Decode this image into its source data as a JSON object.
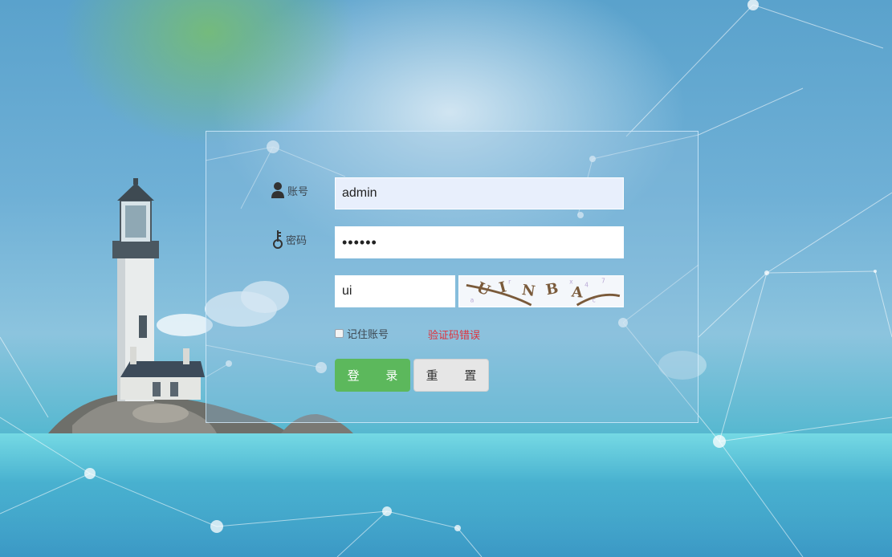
{
  "login": {
    "account_label": "账号",
    "password_label": "密码",
    "account_value": "admin",
    "password_value": "••••••",
    "captcha_value": "ui",
    "captcha_chars": [
      "U",
      "I",
      "N",
      "B",
      "A"
    ],
    "remember_label": "记住账号",
    "error_message": "验证码错误",
    "login_button": "登 录",
    "reset_button": "重 置",
    "remember_checked": false
  },
  "icons": {
    "account": "user-icon",
    "password": "key-icon"
  },
  "colors": {
    "login_button": "#5cb85c",
    "error": "#e0303a",
    "reset_button": "#e6e6e6"
  }
}
